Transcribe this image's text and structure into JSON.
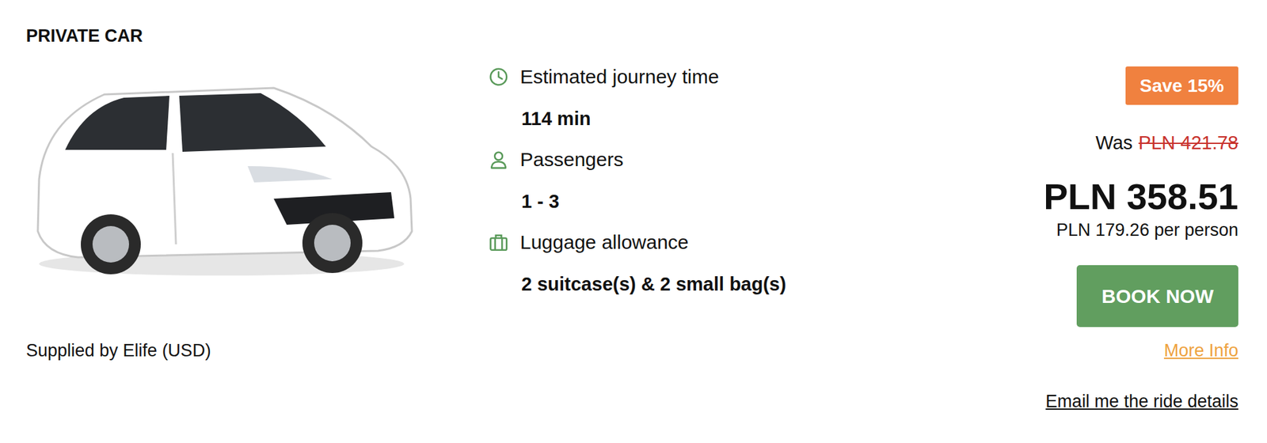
{
  "title": "PRIVATE CAR",
  "supplier": "Supplied by Elife (USD)",
  "details": [
    {
      "label": "Estimated journey time",
      "value": "114 min",
      "kind": "clock"
    },
    {
      "label": "Passengers",
      "value": "1 - 3",
      "kind": "person"
    },
    {
      "label": "Luggage allowance",
      "value": "2 suitcase(s) & 2 small bag(s)",
      "kind": "luggage"
    }
  ],
  "badge": "Save 15%",
  "was_label": "Was",
  "old_price": "PLN 421.78",
  "price": "PLN 358.51",
  "per_person": "PLN 179.26 per person",
  "buttons": [
    "BOOK NOW"
  ],
  "links": [
    "More Info",
    "Email me the ride details"
  ]
}
